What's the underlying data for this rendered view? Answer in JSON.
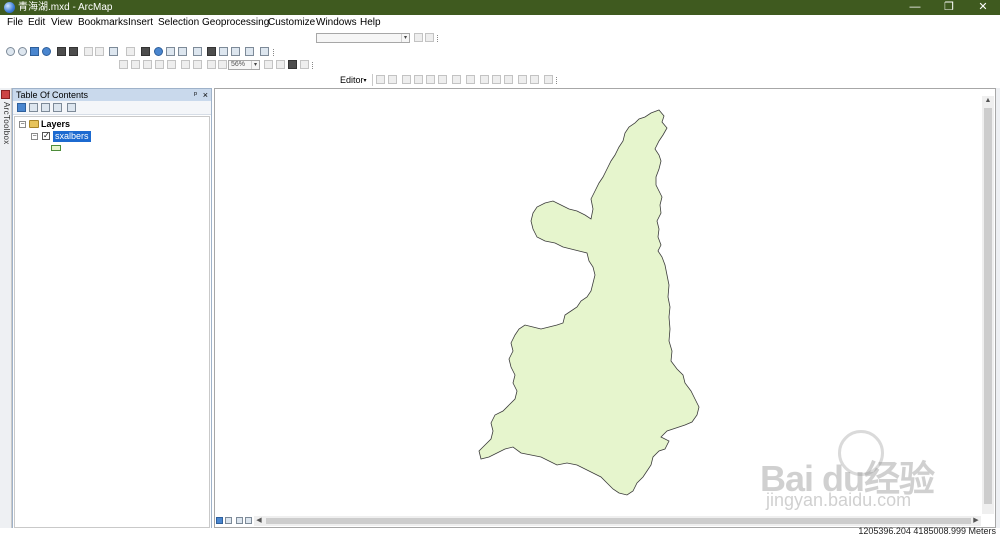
{
  "window": {
    "title": "青海湖.mxd - ArcMap",
    "controls": [
      "—",
      "❐",
      "✕"
    ]
  },
  "menu": [
    "File",
    "Edit",
    "View",
    "Bookmarks",
    "Insert",
    "Selection",
    "Geoprocessing",
    "Customize",
    "Windows",
    "Help"
  ],
  "toolbar": {
    "zoom_value": "56%",
    "editor_label": "Editor"
  },
  "left_strip": {
    "label": "ArcToolbox"
  },
  "toc": {
    "title": "Table Of Contents",
    "pin_glyph": "ᵖ",
    "close_glyph": "×",
    "root_label": "Layers",
    "layer_name": "sxalbers",
    "layer_checked": "✓"
  },
  "status": {
    "coordinates": "1205396.204 4185008.999 Meters"
  },
  "watermark": {
    "brand": "Bai du经验",
    "url": "jingyan.baidu.com"
  },
  "colors": {
    "polygon_fill": "#e6f5cd",
    "polygon_stroke": "#3c3c3c",
    "titlebar_bg": "#3f5a1f",
    "selection": "#1c6ad0"
  }
}
